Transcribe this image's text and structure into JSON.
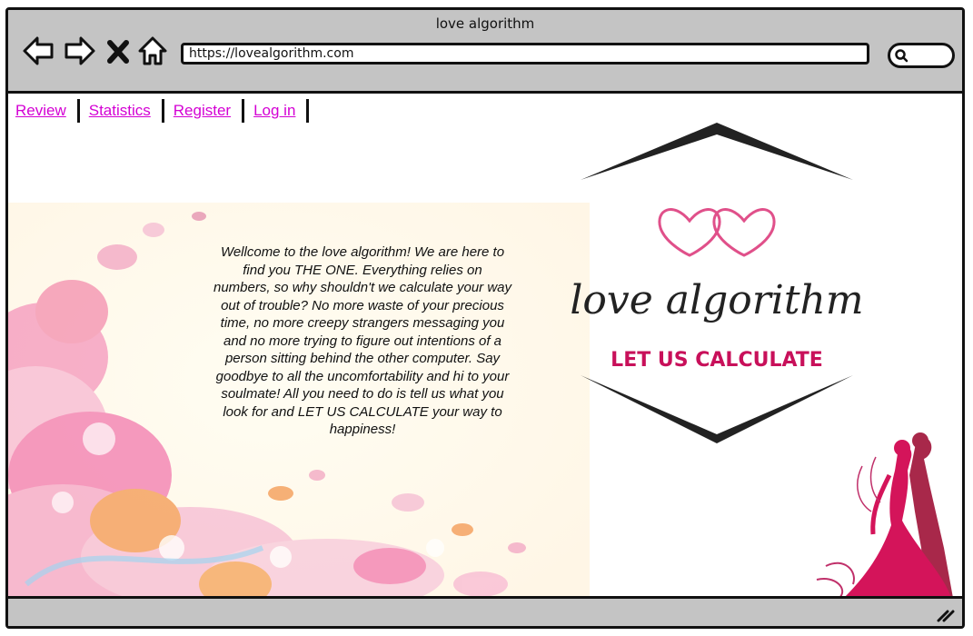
{
  "window": {
    "title": "love algorithm"
  },
  "browser": {
    "url": "https://lovealgorithm.com",
    "icons": [
      "back-arrow-icon",
      "forward-arrow-icon",
      "stop-x-icon",
      "home-icon",
      "search-icon"
    ]
  },
  "nav": {
    "links": [
      {
        "label": "Review"
      },
      {
        "label": "Statistics"
      },
      {
        "label": "Register"
      },
      {
        "label": "Log in"
      }
    ]
  },
  "main": {
    "welcome_text": "Wellcome to the love algorithm! We are here to find you THE ONE. Everything relies on numbers, so why shouldn't we calculate your way out of trouble? No more waste of your precious time, no more creepy strangers messaging you and no more trying to figure out intentions of a person sitting behind the other computer. Say goodbye to all the uncomfortability and hi to your soulmate! All you need to do is tell us what you look for and LET US CALCULATE your way to happiness!"
  },
  "logo": {
    "name": "love algorithm",
    "tagline": "LET US CALCULATE"
  },
  "colors": {
    "link": "#d400d4",
    "chrome": "#c4c4c4",
    "tagline": "#c8105a",
    "heart": "#e0508a"
  }
}
